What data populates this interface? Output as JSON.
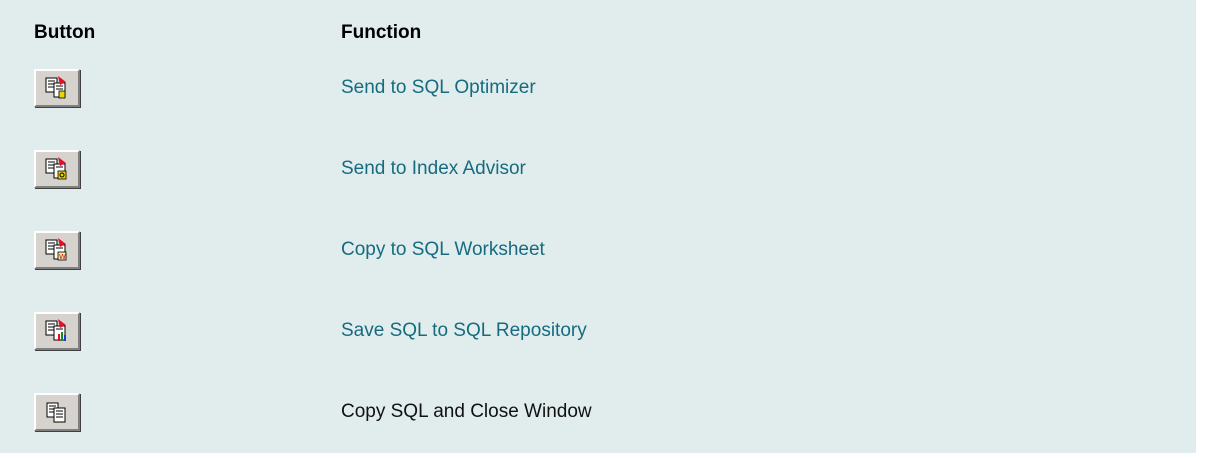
{
  "table": {
    "headers": {
      "button": "Button",
      "function": "Function"
    },
    "rows": [
      {
        "icon": "send-to-sql-optimizer-icon",
        "label": "Send to SQL Optimizer",
        "is_link": true
      },
      {
        "icon": "send-to-index-advisor-icon",
        "label": "Send to Index Advisor",
        "is_link": true
      },
      {
        "icon": "copy-to-sql-worksheet-icon",
        "label": "Copy to SQL Worksheet",
        "is_link": true
      },
      {
        "icon": "save-sql-to-repository-icon",
        "label": "Save SQL to SQL Repository",
        "is_link": true
      },
      {
        "icon": "copy-sql-and-close-icon",
        "label": "Copy SQL and Close Window",
        "is_link": false
      }
    ]
  },
  "colors": {
    "background": "#e1eded",
    "link": "#166b80",
    "text": "#111111"
  }
}
